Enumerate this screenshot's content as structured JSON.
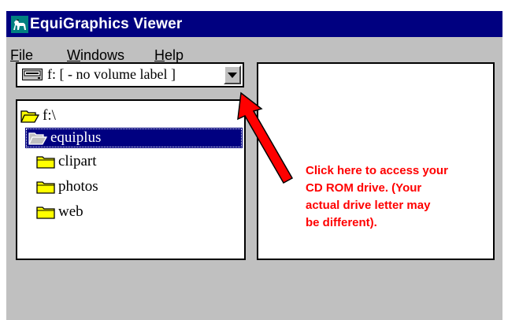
{
  "window": {
    "title": "EquiGraphics Viewer",
    "title_bar_color": "#000080",
    "background": "#c0c0c0"
  },
  "menu": {
    "items": [
      {
        "pre": "",
        "accel": "F",
        "post": "ile"
      },
      {
        "pre": "",
        "accel": "W",
        "post": "indows"
      },
      {
        "pre": "",
        "accel": "H",
        "post": "elp"
      }
    ]
  },
  "drive_combo": {
    "icon": "drive-icon",
    "value": "f: [ - no volume label ]"
  },
  "tree": {
    "items": [
      {
        "label": "f:\\",
        "icon": "open-folder-icon",
        "selected": false
      },
      {
        "label": "equiplus",
        "icon": "open-folder-icon",
        "selected": true
      },
      {
        "label": "clipart",
        "icon": "folder-icon",
        "selected": false
      },
      {
        "label": "photos",
        "icon": "folder-icon",
        "selected": false
      },
      {
        "label": "web",
        "icon": "folder-icon",
        "selected": false
      }
    ]
  },
  "annotation": {
    "color": "#ff0000",
    "lines": [
      "Click here to access your",
      "CD ROM drive. (Your",
      "actual drive letter may",
      "be different)."
    ]
  }
}
